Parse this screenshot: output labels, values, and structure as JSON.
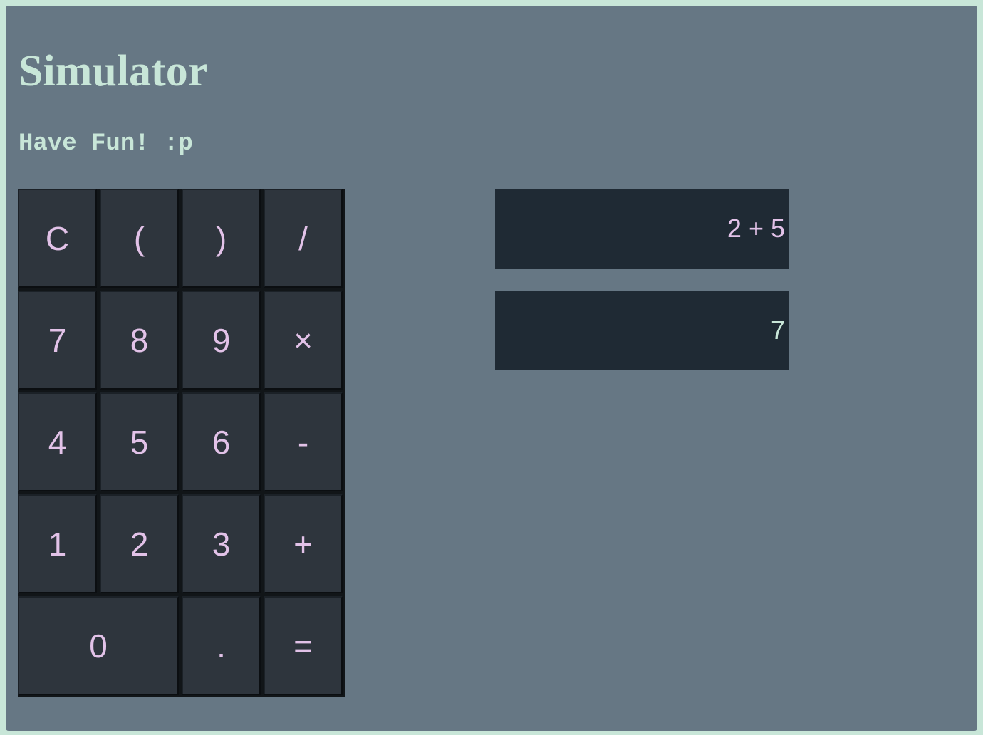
{
  "header": {
    "title": "Simulator",
    "subtitle": "Have Fun! :p"
  },
  "keypad": {
    "rows": [
      [
        "C",
        "(",
        ")",
        "/"
      ],
      [
        "7",
        "8",
        "9",
        "×"
      ],
      [
        "4",
        "5",
        "6",
        "-"
      ],
      [
        "1",
        "2",
        "3",
        "+"
      ],
      [
        "0",
        ".",
        "="
      ]
    ]
  },
  "display": {
    "expression": "2 + 5",
    "result": "7"
  },
  "colors": {
    "background": "#667784",
    "frame": "#c8e6d8",
    "key": "#2e353d",
    "key_text": "#e2c2e8",
    "display": "#1f2a34"
  }
}
